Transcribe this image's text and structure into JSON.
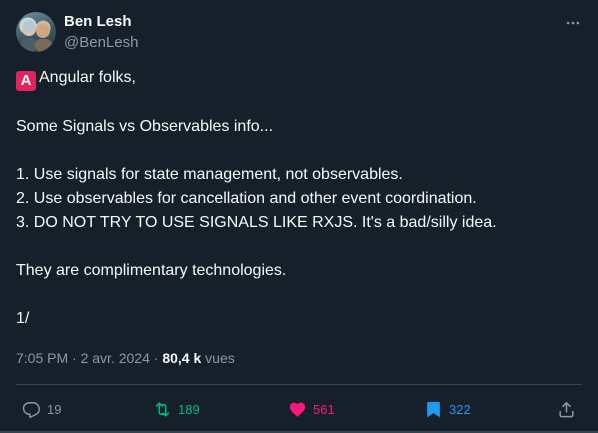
{
  "author": {
    "name": "Ben Lesh",
    "handle": "@BenLesh"
  },
  "tweet": {
    "emoji": "A",
    "lines": [
      "Angular folks,",
      "",
      "Some Signals vs Observables info...",
      "",
      "1. Use signals for state management, not observables.",
      "2. Use observables for cancellation and other event coordination.",
      "3. DO NOT TRY TO USE SIGNALS LIKE RXJS. It's a bad/silly idea.",
      "",
      "They are complimentary technologies.",
      "",
      "1/"
    ]
  },
  "meta": {
    "time": "7:05 PM",
    "separator": "·",
    "date": "2 avr. 2024",
    "views_count": "80,4 k",
    "views_label": "vues"
  },
  "actions": {
    "reply_count": "19",
    "retweet_count": "189",
    "like_count": "561",
    "bookmark_count": "322"
  },
  "colors": {
    "background": "#15202b",
    "retweet": "#00ba7c",
    "like": "#f91880",
    "bookmark": "#1d9bf0",
    "muted": "#8b98a5"
  },
  "icons": {
    "more": "more-horizontal-icon",
    "reply": "reply-icon",
    "retweet": "retweet-icon",
    "like": "heart-icon",
    "bookmark": "bookmark-icon",
    "share": "share-icon"
  }
}
